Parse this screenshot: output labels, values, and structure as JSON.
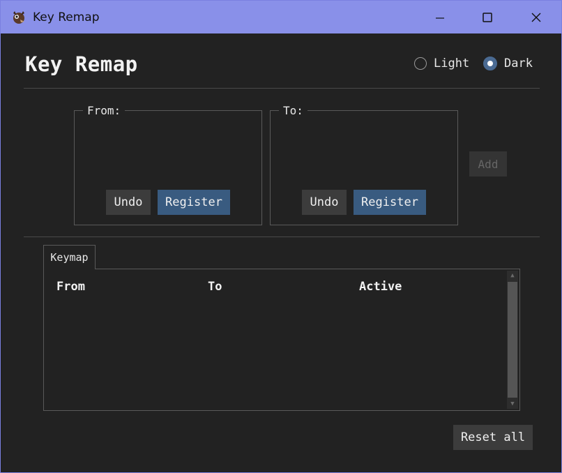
{
  "window": {
    "title": "Key Remap",
    "minimize_icon": "minimize-icon",
    "maximize_icon": "maximize-icon",
    "close_icon": "close-icon"
  },
  "header": {
    "title": "Key Remap",
    "theme": {
      "light_label": "Light",
      "dark_label": "Dark",
      "selected": "Dark"
    }
  },
  "from_group": {
    "label": "From:",
    "undo_label": "Undo",
    "register_label": "Register"
  },
  "to_group": {
    "label": "To:",
    "undo_label": "Undo",
    "register_label": "Register"
  },
  "add_label": "Add",
  "keymap": {
    "tab_label": "Keymap",
    "columns": [
      "From",
      "To",
      "Active"
    ],
    "rows": []
  },
  "reset_label": "Reset all",
  "colors": {
    "titlebar": "#8990e9",
    "background": "#222222",
    "accent_button": "#395b80",
    "neutral_button": "#3c3c3c"
  }
}
